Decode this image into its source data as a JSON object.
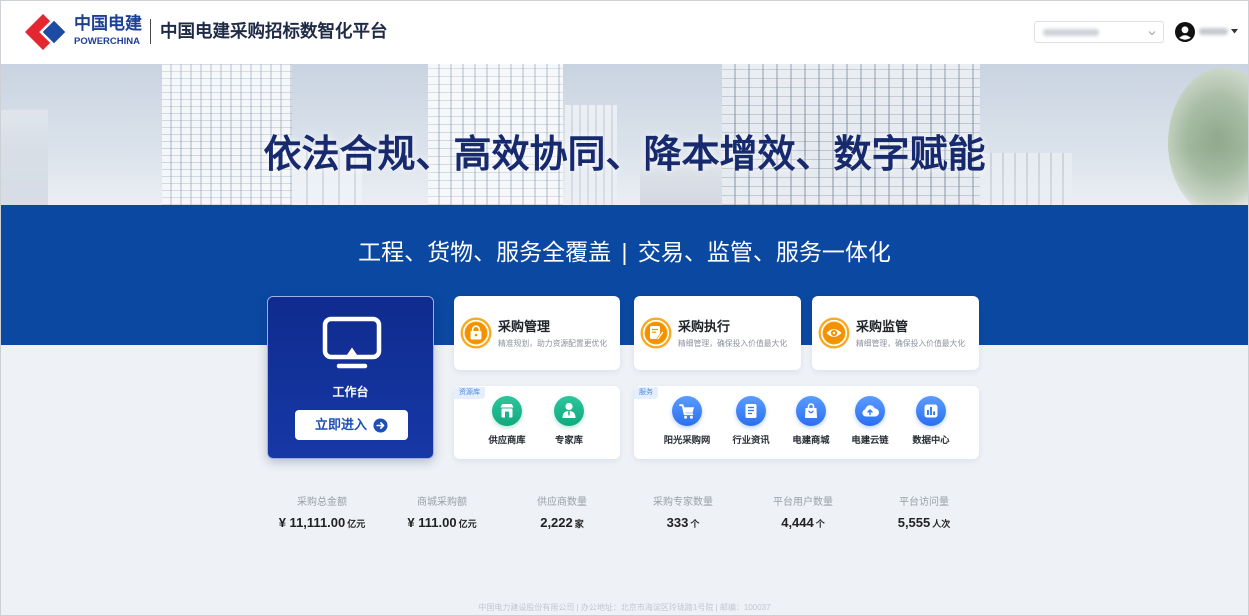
{
  "header": {
    "logo_cn": "中国电建",
    "logo_en": "POWERCHINA",
    "platform_title": "中国电建采购招标数智化平台"
  },
  "hero": {
    "slogan": "依法合规、高效协同、降本增效、数字赋能"
  },
  "band": {
    "tagline_left": "工程、货物、服务全覆盖",
    "separator": "|",
    "tagline_right": "交易、监管、服务一体化"
  },
  "workbench": {
    "label": "工作台",
    "enter_label": "立即进入",
    "icon": "monitor-icon"
  },
  "features": [
    {
      "title": "采购管理",
      "desc": "精准规划，助力资源配置更优化",
      "icon": "lock-bag-icon"
    },
    {
      "title": "采购执行",
      "desc": "精细管理，确保投入价值最大化",
      "icon": "document-edit-icon"
    },
    {
      "title": "采购监管",
      "desc": "精细管理，确保投入价值最大化",
      "icon": "eye-icon"
    }
  ],
  "resources": {
    "tag": "资源库",
    "items": [
      {
        "label": "供应商库",
        "icon": "store-icon"
      },
      {
        "label": "专家库",
        "icon": "expert-icon"
      }
    ]
  },
  "services": {
    "tag": "服务",
    "items": [
      {
        "label": "阳光采购网",
        "icon": "cart-icon"
      },
      {
        "label": "行业资讯",
        "icon": "news-icon"
      },
      {
        "label": "电建商城",
        "icon": "shopping-bag-icon"
      },
      {
        "label": "电建云链",
        "icon": "cloud-icon"
      },
      {
        "label": "数据中心",
        "icon": "bar-chart-icon"
      }
    ]
  },
  "stats": [
    {
      "label": "采购总金额",
      "value": "¥ 11,111.00",
      "unit": "亿元"
    },
    {
      "label": "商城采购额",
      "value": "¥ 111.00",
      "unit": "亿元"
    },
    {
      "label": "供应商数量",
      "value": "2,222",
      "unit": "家"
    },
    {
      "label": "采购专家数量",
      "value": "333",
      "unit": "个"
    },
    {
      "label": "平台用户数量",
      "value": "4,444",
      "unit": "个"
    },
    {
      "label": "平台访问量",
      "value": "5,555",
      "unit": "人次"
    }
  ],
  "footer": {
    "text": "中国电力建设股份有限公司 | 办公地址：北京市海淀区玲珑路1号院 | 邮编：100037"
  },
  "colors": {
    "brand_blue": "#1d3f95",
    "band_blue": "#0b48a2",
    "workbench_blue": "#0f2b8e",
    "feature_orange": "#f39200",
    "resource_green": "#17b58b",
    "service_blue": "#2a6ff0",
    "page_bg": "#eef1f6"
  }
}
